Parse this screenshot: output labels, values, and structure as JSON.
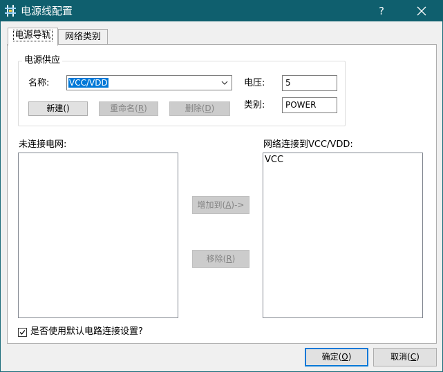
{
  "window": {
    "title": "电源线配置",
    "help_glyph": "?",
    "icon": "power-rail-icon"
  },
  "tabs": [
    {
      "label": "电源导轨",
      "active": true
    },
    {
      "label": "网络类别",
      "active": false
    }
  ],
  "power_supply": {
    "group_title": "电源供应",
    "name_label": "名称:",
    "name_value": "VCC/VDD",
    "voltage_label": "电压:",
    "voltage_value": "5",
    "category_label": "类别:",
    "category_value": "POWER",
    "new_button": "新建()",
    "rename_button": {
      "text": "重命名(",
      "key": "R",
      "tail": ")"
    },
    "delete_button": {
      "text": "删除(",
      "key": "D",
      "tail": ")"
    }
  },
  "unconnected": {
    "label": "未连接电网:",
    "items": []
  },
  "connected": {
    "label": "网络连接到VCC/VDD:",
    "items": [
      "VCC"
    ]
  },
  "middle_buttons": {
    "add": {
      "text": "增加到(",
      "key": "A",
      "tail": ")->"
    },
    "remove": {
      "text": "移除(",
      "key": "R",
      "tail": ")"
    }
  },
  "default_checkbox": {
    "label": "是否使用默认电路连接设置?",
    "checked": true
  },
  "footer": {
    "ok": {
      "text": "确定(",
      "key": "O",
      "tail": ")"
    },
    "cancel": {
      "text": "取消(",
      "key": "C",
      "tail": ")"
    }
  },
  "colors": {
    "titlebar": "#0f5f6e",
    "focus": "#0078d7",
    "selection": "#0078d7"
  }
}
